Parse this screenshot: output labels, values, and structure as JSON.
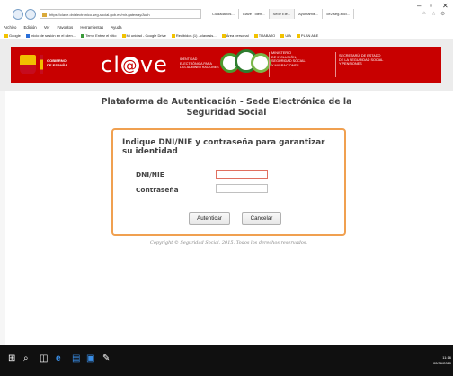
{
  "browser": {
    "address": "https://clave.dnielectronico.seg-social.gob.es/mir-gateway/Auth",
    "tabs": [
      "Ciudadanos...",
      "Clave · Iden...",
      "Sede Ele...",
      "Ayuntamie...",
      "ce2.seg-soci..."
    ],
    "active_tab": 2,
    "menu": [
      "Archivo",
      "Edición",
      "Ver",
      "Favoritos",
      "Herramientas",
      "Ayuda"
    ],
    "favorites": [
      "Google",
      "Inicio de sesión en el clien...",
      "Temp Entrar el sitio",
      "Mi unidad - Google Drive",
      "Recibidos (1) - clavesis...",
      "Área personal",
      "TRABAJO",
      "UIA",
      "PLAN ABE"
    ]
  },
  "banner": {
    "gobierno": [
      "GOBIERNO",
      "DE ESPAÑA"
    ],
    "clave_left": "cl",
    "clave_at": "@",
    "clave_right": "ve",
    "clave_sub": [
      "IDENTIDAD",
      "ELECTRÓNICA PARA",
      "LAS ADMINISTRACIONES"
    ],
    "ministerio": [
      "MINISTERIO",
      "DE INCLUSIÓN,",
      "SEGURIDAD SOCIAL",
      "Y MIGRACIONES"
    ],
    "secretaria": [
      "SECRETARÍA DE ESTADO",
      "DE LA SEGURIDAD SOCIAL",
      "Y PENSIONES"
    ],
    "colors": {
      "primary": "#c80000",
      "ss_green": "#2f7d2f"
    }
  },
  "page": {
    "title_line1": "Plataforma de Autenticación - Sede Electrónica de la",
    "title_line2": "Seguridad Social"
  },
  "form": {
    "heading": "Indique DNI/NIE y contraseña para garantizar su identidad",
    "dni_label": "DNI/NIE",
    "dni_value": "",
    "password_label": "Contraseña",
    "password_value": "",
    "submit_label": "Autenticar",
    "cancel_label": "Cancelar",
    "accent": "#f0a050"
  },
  "footer": {
    "copyright": "Copyright © Seguridad Social. 2015. Todos los derechos reservados."
  },
  "taskbar": {
    "time": "11:16",
    "date": "02/06/2020"
  }
}
